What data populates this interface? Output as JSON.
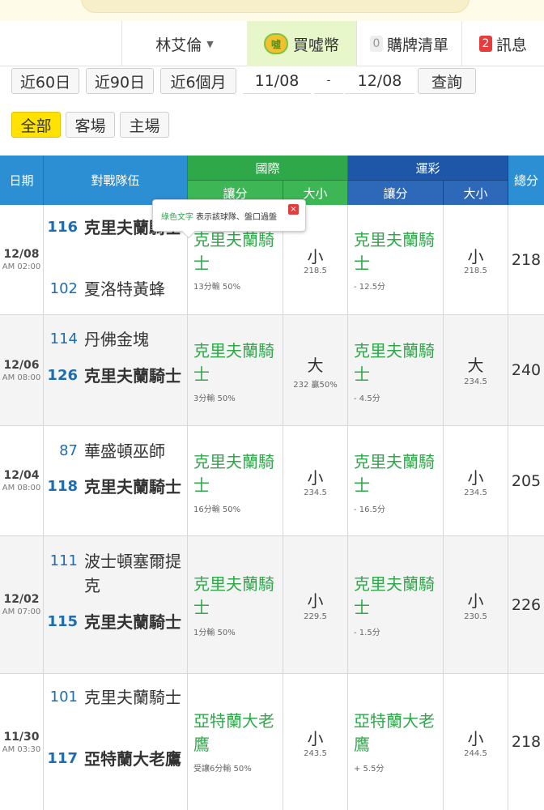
{
  "nav": {
    "user": "林艾倫",
    "coin_icon_text": "噓",
    "coin_label": "買噓幣",
    "cart_count": "0",
    "cart_label": "購牌清單",
    "msg_count": "2",
    "msg_label": "訊息"
  },
  "filters": {
    "range_60": "近60日",
    "range_90": "近90日",
    "range_6m": "近6個月",
    "date_from": "11/08",
    "date_sep": "-",
    "date_to": "12/08",
    "query": "查詢",
    "tab_all": "全部",
    "tab_away": "客場",
    "tab_home": "主場"
  },
  "table": {
    "headers": {
      "date": "日期",
      "teams": "對戰隊伍",
      "intl": "國際",
      "lottery": "運彩",
      "spread": "讓分",
      "ou": "大小",
      "total": "總分"
    },
    "rows": [
      {
        "date": "12/08",
        "time": "AM 02:00",
        "team1_num": "116",
        "team1_name": "克里夫蘭騎士",
        "team2_num": "102",
        "team2_name": "夏洛特黃蜂",
        "intl_pick": "克里夫蘭騎士",
        "intl_spread": "13分輸 50%",
        "intl_ou": "小",
        "intl_ou_line": "218.5",
        "lot_pick": "克里夫蘭騎士",
        "lot_spread": "- 12.5分",
        "lot_ou": "小",
        "lot_ou_line": "218.5",
        "total": "218"
      },
      {
        "date": "12/06",
        "time": "AM 08:00",
        "team1_num": "114",
        "team1_name": "丹佛金塊",
        "team2_num": "126",
        "team2_name": "克里夫蘭騎士",
        "intl_pick": "克里夫蘭騎士",
        "intl_spread": "3分輸 50%",
        "intl_ou": "大",
        "intl_ou_line": "232 贏50%",
        "lot_pick": "克里夫蘭騎士",
        "lot_spread": "- 4.5分",
        "lot_ou": "大",
        "lot_ou_line": "234.5",
        "total": "240"
      },
      {
        "date": "12/04",
        "time": "AM 08:00",
        "team1_num": "87",
        "team1_name": "華盛頓巫師",
        "team2_num": "118",
        "team2_name": "克里夫蘭騎士",
        "intl_pick": "克里夫蘭騎士",
        "intl_spread": "16分輸 50%",
        "intl_ou": "小",
        "intl_ou_line": "234.5",
        "lot_pick": "克里夫蘭騎士",
        "lot_spread": "- 16.5分",
        "lot_ou": "小",
        "lot_ou_line": "234.5",
        "total": "205"
      },
      {
        "date": "12/02",
        "time": "AM 07:00",
        "team1_num": "111",
        "team1_name": "波士頓塞爾提克",
        "team2_num": "115",
        "team2_name": "克里夫蘭騎士",
        "intl_pick": "克里夫蘭騎士",
        "intl_spread": "1分輸 50%",
        "intl_ou": "小",
        "intl_ou_line": "229.5",
        "lot_pick": "克里夫蘭騎士",
        "lot_spread": "- 1.5分",
        "lot_ou": "小",
        "lot_ou_line": "230.5",
        "total": "226"
      },
      {
        "date": "11/30",
        "time": "AM 03:30",
        "team1_num": "101",
        "team1_name": "克里夫蘭騎士",
        "team2_num": "117",
        "team2_name": "亞特蘭大老鷹",
        "intl_pick": "亞特蘭大老鷹",
        "intl_spread": "受讓6分輸 50%",
        "intl_ou": "小",
        "intl_ou_line": "243.5",
        "lot_pick": "亞特蘭大老鷹",
        "lot_spread": "+ 5.5分",
        "lot_ou": "小",
        "lot_ou_line": "244.5",
        "total": "218"
      }
    ]
  },
  "tooltip": {
    "green_text": "綠色文字",
    "text": "表示該球隊、盤口過盤",
    "close": "×"
  },
  "colors": {
    "accent_green": "#2fa84a",
    "header_blue": "#2c8fd3",
    "header_navy": "#1f57a8",
    "team_number_blue": "#1c6db3",
    "active_tab_yellow": "#ffe200",
    "badge_red": "#e83c3c"
  }
}
